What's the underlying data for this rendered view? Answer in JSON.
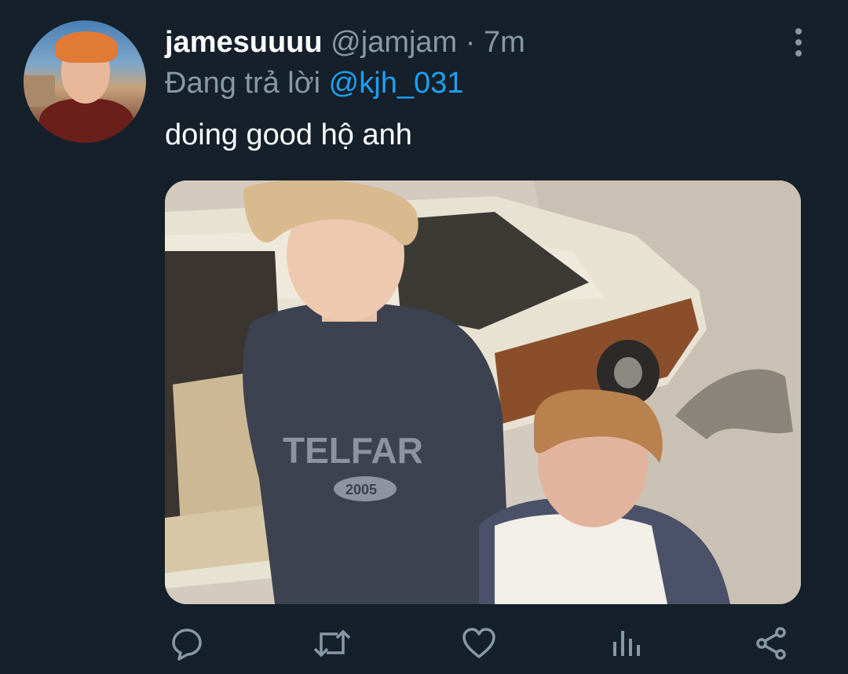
{
  "tweet": {
    "display_name": "jamesuuuu",
    "handle": "@jamjam",
    "separator": "·",
    "time": "7m",
    "reply_prefix": "Đang trả lời",
    "reply_to": "@kjh_031",
    "text": "doing good hộ anh"
  },
  "media": {
    "shirt_text": "TELFAR",
    "shirt_badge": "2005"
  },
  "icons": {
    "more": "more-vertical-icon",
    "reply": "reply-icon",
    "retweet": "retweet-icon",
    "like": "heart-icon",
    "analytics": "analytics-icon",
    "share": "share-icon"
  },
  "colors": {
    "background": "#15202b",
    "secondary_text": "#8899a6",
    "link": "#1da1f2",
    "primary_text": "#ffffff"
  }
}
